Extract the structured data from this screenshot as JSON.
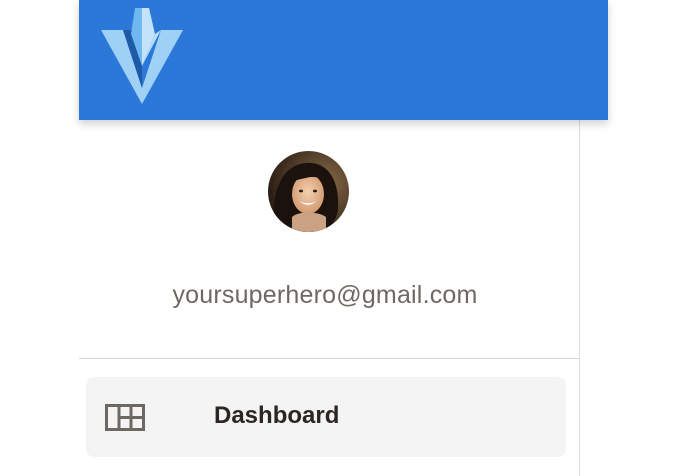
{
  "header": {
    "logo_icon": "vuetify-v-logo-icon",
    "background_color": "#2b78d8"
  },
  "profile": {
    "avatar_icon": "user-avatar-photo",
    "email": "yoursuperhero@gmail.com"
  },
  "nav": {
    "items": [
      {
        "label": "Dashboard",
        "icon": "dashboard-grid-icon",
        "active": true
      }
    ]
  },
  "colors": {
    "accent": "#2b78d8",
    "text_secondary": "#6e6862",
    "text_primary": "#2a2622",
    "active_item_bg": "#f4f4f4"
  }
}
